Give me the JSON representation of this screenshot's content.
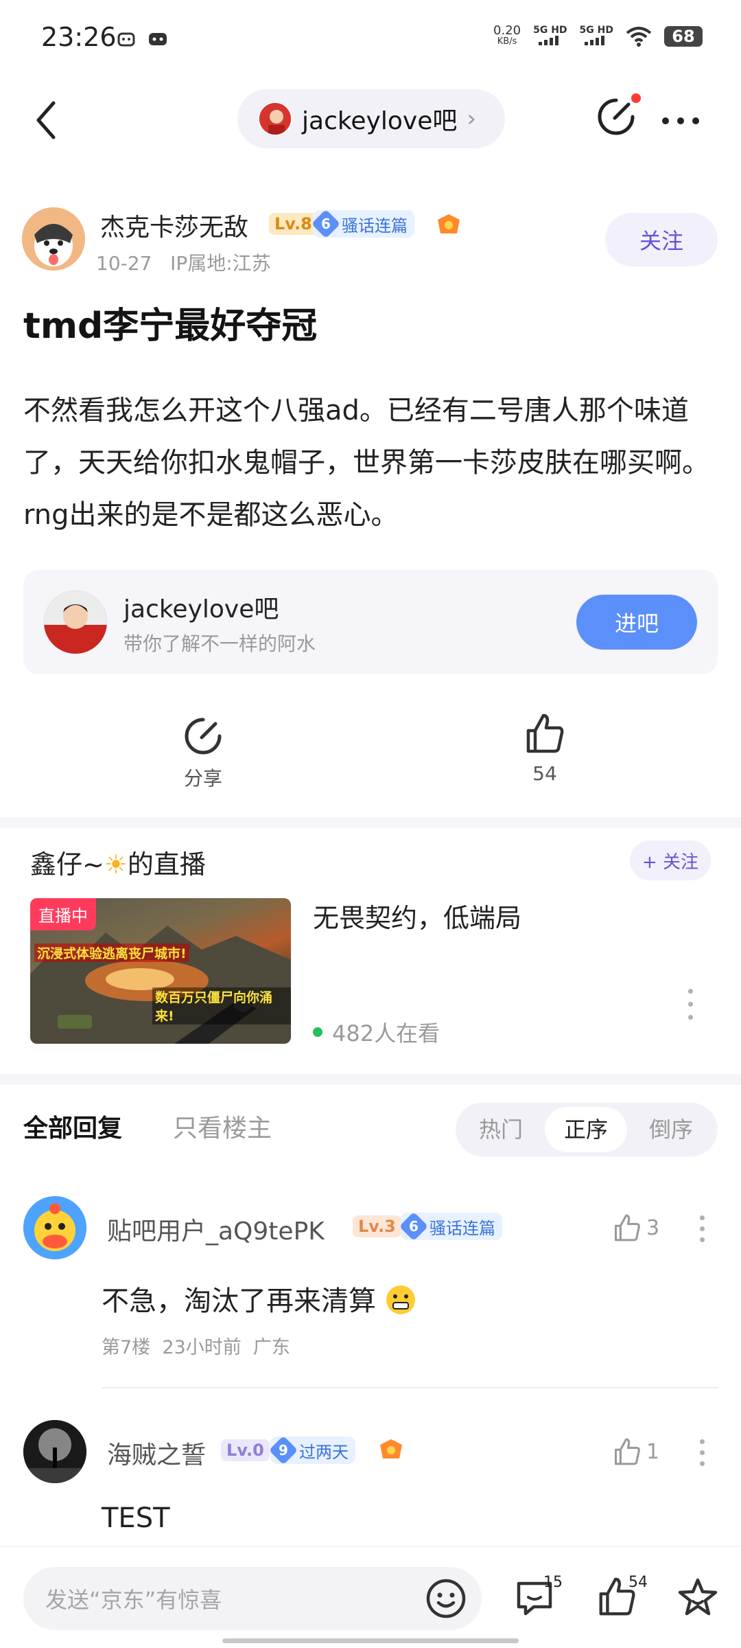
{
  "status_bar": {
    "time": "23:26",
    "net_speed": "0.20",
    "net_unit": "KB/s",
    "signal1": "5G HD",
    "signal2": "5G HD",
    "battery": "68"
  },
  "header": {
    "forum_name": "jackeylove吧"
  },
  "post": {
    "author": "杰克卡莎无敌",
    "level": "Lv.8",
    "badge_level": "6",
    "badge_text": "骚话连篇",
    "date": "10-27",
    "ip": "IP属地:江苏",
    "follow_label": "关注",
    "title": "tmd李宁最好夺冠",
    "body": "不然看我怎么开这个八强ad。已经有二号唐人那个味道了，天天给你扣水鬼帽子，世界第一卡莎皮肤在哪买啊。rng出来的是不是都这么恶心。"
  },
  "forum_card": {
    "name": "jackeylove吧",
    "desc": "带你了解不一样的阿水",
    "button": "进吧"
  },
  "actions": {
    "share_label": "分享",
    "like_count": "54"
  },
  "live": {
    "title_prefix": "鑫仔~",
    "title_suffix": "的直播",
    "follow_label": "+ 关注",
    "tag": "直播中",
    "thumb_caption1": "沉浸式体验逃离丧尸城市!",
    "thumb_caption2": "数百万只僵尸向你涌来!",
    "stream_name": "无畏契约，低端局",
    "viewers": "482人在看"
  },
  "tabs": {
    "all": "全部回复",
    "op_only": "只看楼主",
    "sort_hot": "热门",
    "sort_asc": "正序",
    "sort_desc": "倒序"
  },
  "replies": [
    {
      "name": "贴吧用户_aQ9tePK",
      "level": "Lv.3",
      "badge_level": "6",
      "badge_text": "骚话连篇",
      "likes": "3",
      "text": "不急，淘汰了再来清算",
      "floor": "第7楼",
      "time": "23小时前",
      "location": "广东"
    },
    {
      "name": "海贼之誓",
      "level": "Lv.0",
      "badge_level": "9",
      "badge_text": "过两天",
      "likes": "1",
      "text": "TEST"
    }
  ],
  "bottom_bar": {
    "input_placeholder": "发送“京东”有惊喜",
    "comment_count": "15",
    "like_count": "54"
  },
  "colors": {
    "accent": "#5b8ff9",
    "follow_text": "#6254d6",
    "live_tag": "#ff3b5c"
  }
}
